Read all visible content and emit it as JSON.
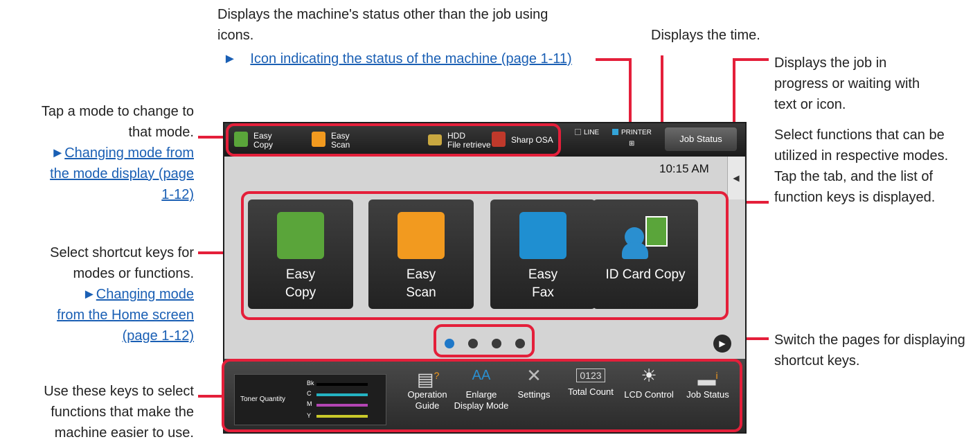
{
  "annotations": {
    "status_desc": "Displays the machine's status other than the job using icons.",
    "status_link": "Icon indicating the status of the machine (page 1-11)",
    "time_desc": "Displays the time.",
    "job_desc": "Displays the job in progress or waiting with text or icon.",
    "mode_desc": "Tap a mode to change to that mode.",
    "mode_link": "Changing mode from the mode display (page 1-12)",
    "shortcut_desc": "Select shortcut keys for modes or functions.",
    "shortcut_link": "Changing mode from the Home screen (page 1-12)",
    "function_desc": "Select functions that can be utilized in respective modes. Tap the tab, and the list of function keys is displayed.",
    "switch_desc": "Switch the pages for displaying shortcut keys.",
    "fixed_desc": "Use these keys to select functions that make the machine easier to use."
  },
  "screen": {
    "modes": [
      {
        "label_1": "Easy",
        "label_2": "Copy",
        "icon": "copy-mode-icon",
        "color": "#5aa53a"
      },
      {
        "label_1": "Easy",
        "label_2": "Scan",
        "icon": "scan-mode-icon",
        "color": "#f29a1f"
      },
      {
        "label_1": "HDD",
        "label_2": "File retrieve",
        "icon": "folder-icon",
        "color": "#c9a840"
      },
      {
        "label_1": "Sharp OSA",
        "label_2": "",
        "icon": "osa-icon",
        "color": "#c0392b"
      }
    ],
    "indicators": {
      "line": "LINE",
      "printer": "PRINTER",
      "printer_color": "#33a4d8"
    },
    "job_status": "Job Status",
    "clock": "10:15 AM",
    "tiles": [
      {
        "label": "Easy\nCopy",
        "icon": "copy-icon",
        "color": "#5aa53a"
      },
      {
        "label": "Easy\nScan",
        "icon": "scan-icon",
        "color": "#f29a1f"
      },
      {
        "label": "Easy\nFax",
        "icon": "fax-icon",
        "color": "#1f8fd1"
      },
      {
        "label": "ID Card Copy",
        "icon": "id-card-copy-icon",
        "color": "#2a8fd0"
      }
    ],
    "page_dots": {
      "count": 4,
      "current": 1,
      "active_color": "#1f78c8"
    },
    "toner": {
      "label": "Toner Quantity",
      "bars": [
        {
          "name": "Bk",
          "color": "#000000"
        },
        {
          "name": "C",
          "color": "#24b3c2"
        },
        {
          "name": "M",
          "color": "#b345b3"
        },
        {
          "name": "Y",
          "color": "#c9c92a"
        }
      ]
    },
    "function_keys": [
      {
        "label": "Operation\nGuide",
        "icon": "operation-guide-icon"
      },
      {
        "label": "Enlarge\nDisplay Mode",
        "icon": "enlarge-display-icon"
      },
      {
        "label": "Settings",
        "icon": "settings-icon"
      },
      {
        "label": "Total Count",
        "icon": "total-count-icon"
      },
      {
        "label": "LCD Control",
        "icon": "lcd-control-icon"
      },
      {
        "label": "Job Status",
        "icon": "job-status-icon"
      }
    ]
  }
}
